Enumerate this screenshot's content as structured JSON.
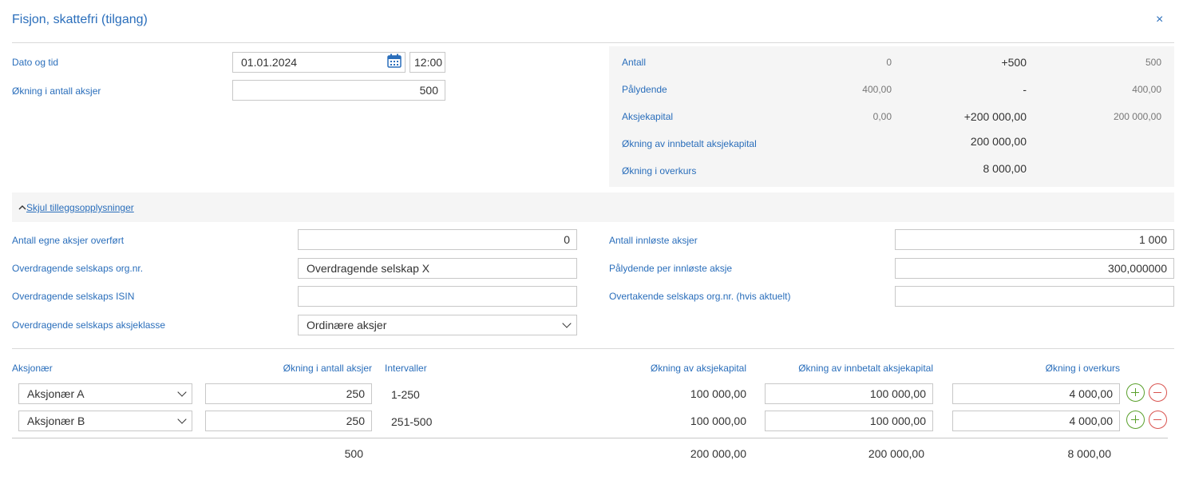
{
  "dialog": {
    "title": "Fisjon, skattefri (tilgang)",
    "close_label": "×"
  },
  "main": {
    "date_label": "Dato og tid",
    "date_value": "01.01.2024",
    "time_value": "12:00",
    "increase_label": "Økning i antall aksjer",
    "increase_value": "500"
  },
  "summary": {
    "rows": [
      {
        "label": "Antall",
        "before": "0",
        "change": "+500",
        "after": "500"
      },
      {
        "label": "Pålydende",
        "before": "400,00",
        "change": "-",
        "after": "400,00"
      },
      {
        "label": "Aksjekapital",
        "before": "0,00",
        "change": "+200 000,00",
        "after": "200 000,00"
      },
      {
        "label": "Økning av innbetalt aksjekapital",
        "before": "",
        "change": "200 000,00",
        "after": ""
      },
      {
        "label": "Økning i overkurs",
        "before": "",
        "change": "8 000,00",
        "after": ""
      }
    ]
  },
  "extra": {
    "toggle_label": "Skjul tilleggsopplysninger",
    "own_shares_label": "Antall egne aksjer overført",
    "own_shares_value": "0",
    "transferor_orgnr_label": "Overdragende selskaps org.nr.",
    "transferor_orgnr_value": "Overdragende selskap X",
    "transferor_isin_label": "Overdragende selskaps ISIN",
    "transferor_isin_value": "",
    "transferor_class_label": "Overdragende selskaps aksjeklasse",
    "transferor_class_value": "Ordinære aksjer",
    "redeemed_label": "Antall innløste aksjer",
    "redeemed_value": "1 000",
    "nominal_redeemed_label": "Pålydende per innløste aksje",
    "nominal_redeemed_value": "300,000000",
    "acquirer_orgnr_label": "Overtakende selskaps org.nr. (hvis aktuelt)",
    "acquirer_orgnr_value": ""
  },
  "table": {
    "headers": {
      "shareholder": "Aksjonær",
      "increase": "Økning i antall aksjer",
      "intervals": "Intervaller",
      "capital": "Økning av aksjekapital",
      "paid_in": "Økning av innbetalt aksjekapital",
      "premium": "Økning i overkurs"
    },
    "rows": [
      {
        "shareholder": "Aksjonær A",
        "increase": "250",
        "interval": "1-250",
        "capital": "100 000,00",
        "paid_in": "100 000,00",
        "premium": "4 000,00"
      },
      {
        "shareholder": "Aksjonær B",
        "increase": "250",
        "interval": "251-500",
        "capital": "100 000,00",
        "paid_in": "100 000,00",
        "premium": "4 000,00"
      }
    ],
    "totals": {
      "increase": "500",
      "capital": "200 000,00",
      "paid_in": "200 000,00",
      "premium": "8 000,00"
    }
  },
  "icons": {
    "calendar": "calendar-icon",
    "add": "plus-circle-icon",
    "remove": "minus-circle-icon",
    "chevron": "chevron-down-icon",
    "collapse": "chevron-up-icon"
  },
  "colors": {
    "accent": "#2a6ebb",
    "add": "#5aa02c",
    "remove": "#d9534f",
    "panel": "#f5f5f5"
  }
}
